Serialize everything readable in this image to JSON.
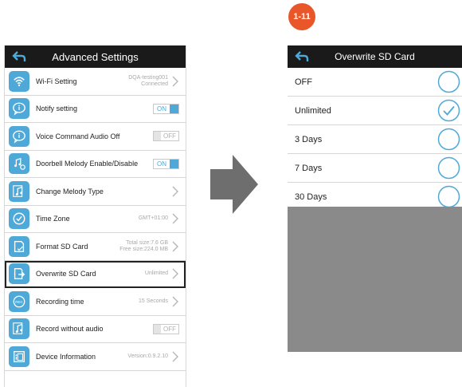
{
  "badge": "1-11",
  "colors": {
    "accent": "#4ea9d8",
    "titlebar": "#1a1a1a",
    "badge": "#e8562a",
    "arrow": "#6e6e6e"
  },
  "left_screen": {
    "title": "Advanced Settings",
    "rows": [
      {
        "icon": "wifi-icon",
        "label": "Wi-Fi Setting",
        "value_line1": "DQA-testing001",
        "value_line2": "Connected",
        "control": "chevron"
      },
      {
        "icon": "info-icon",
        "label": "Notify setting",
        "toggle": "ON",
        "control": "toggle-on"
      },
      {
        "icon": "info-icon",
        "label": "Voice Command Audio Off",
        "toggle": "OFF",
        "control": "toggle-off"
      },
      {
        "icon": "music-settings-icon",
        "label": "Doorbell Melody Enable/Disable",
        "toggle": "ON",
        "control": "toggle-on"
      },
      {
        "icon": "music-icon",
        "label": "Change Melody Type",
        "control": "chevron"
      },
      {
        "icon": "clock-icon",
        "label": "Time Zone",
        "value_line1": "GMT+01:00",
        "control": "chevron"
      },
      {
        "icon": "sd-card-icon",
        "label": "Format SD Card",
        "value_line1": "Total size:7.6 GB",
        "value_line2": "Free size:224.0 MB",
        "control": "chevron"
      },
      {
        "icon": "overwrite-icon",
        "label": "Overwrite SD Card",
        "value_line1": "Unlimited",
        "control": "chevron",
        "highlight": true
      },
      {
        "icon": "rec-icon",
        "label": "Recording time",
        "value_line1": "15 Seconds",
        "control": "chevron"
      },
      {
        "icon": "music-icon",
        "label": "Record without audio",
        "toggle": "OFF",
        "control": "toggle-off"
      },
      {
        "icon": "device-info-icon",
        "label": "Device Information",
        "value_line1": "Version:0.9.2.10",
        "control": "chevron"
      }
    ]
  },
  "right_screen": {
    "title": "Overwrite SD Card",
    "options": [
      {
        "label": "OFF",
        "selected": false
      },
      {
        "label": "Unlimited",
        "selected": true
      },
      {
        "label": "3 Days",
        "selected": false
      },
      {
        "label": "7 Days",
        "selected": false
      },
      {
        "label": "30 Days",
        "selected": false
      }
    ]
  }
}
